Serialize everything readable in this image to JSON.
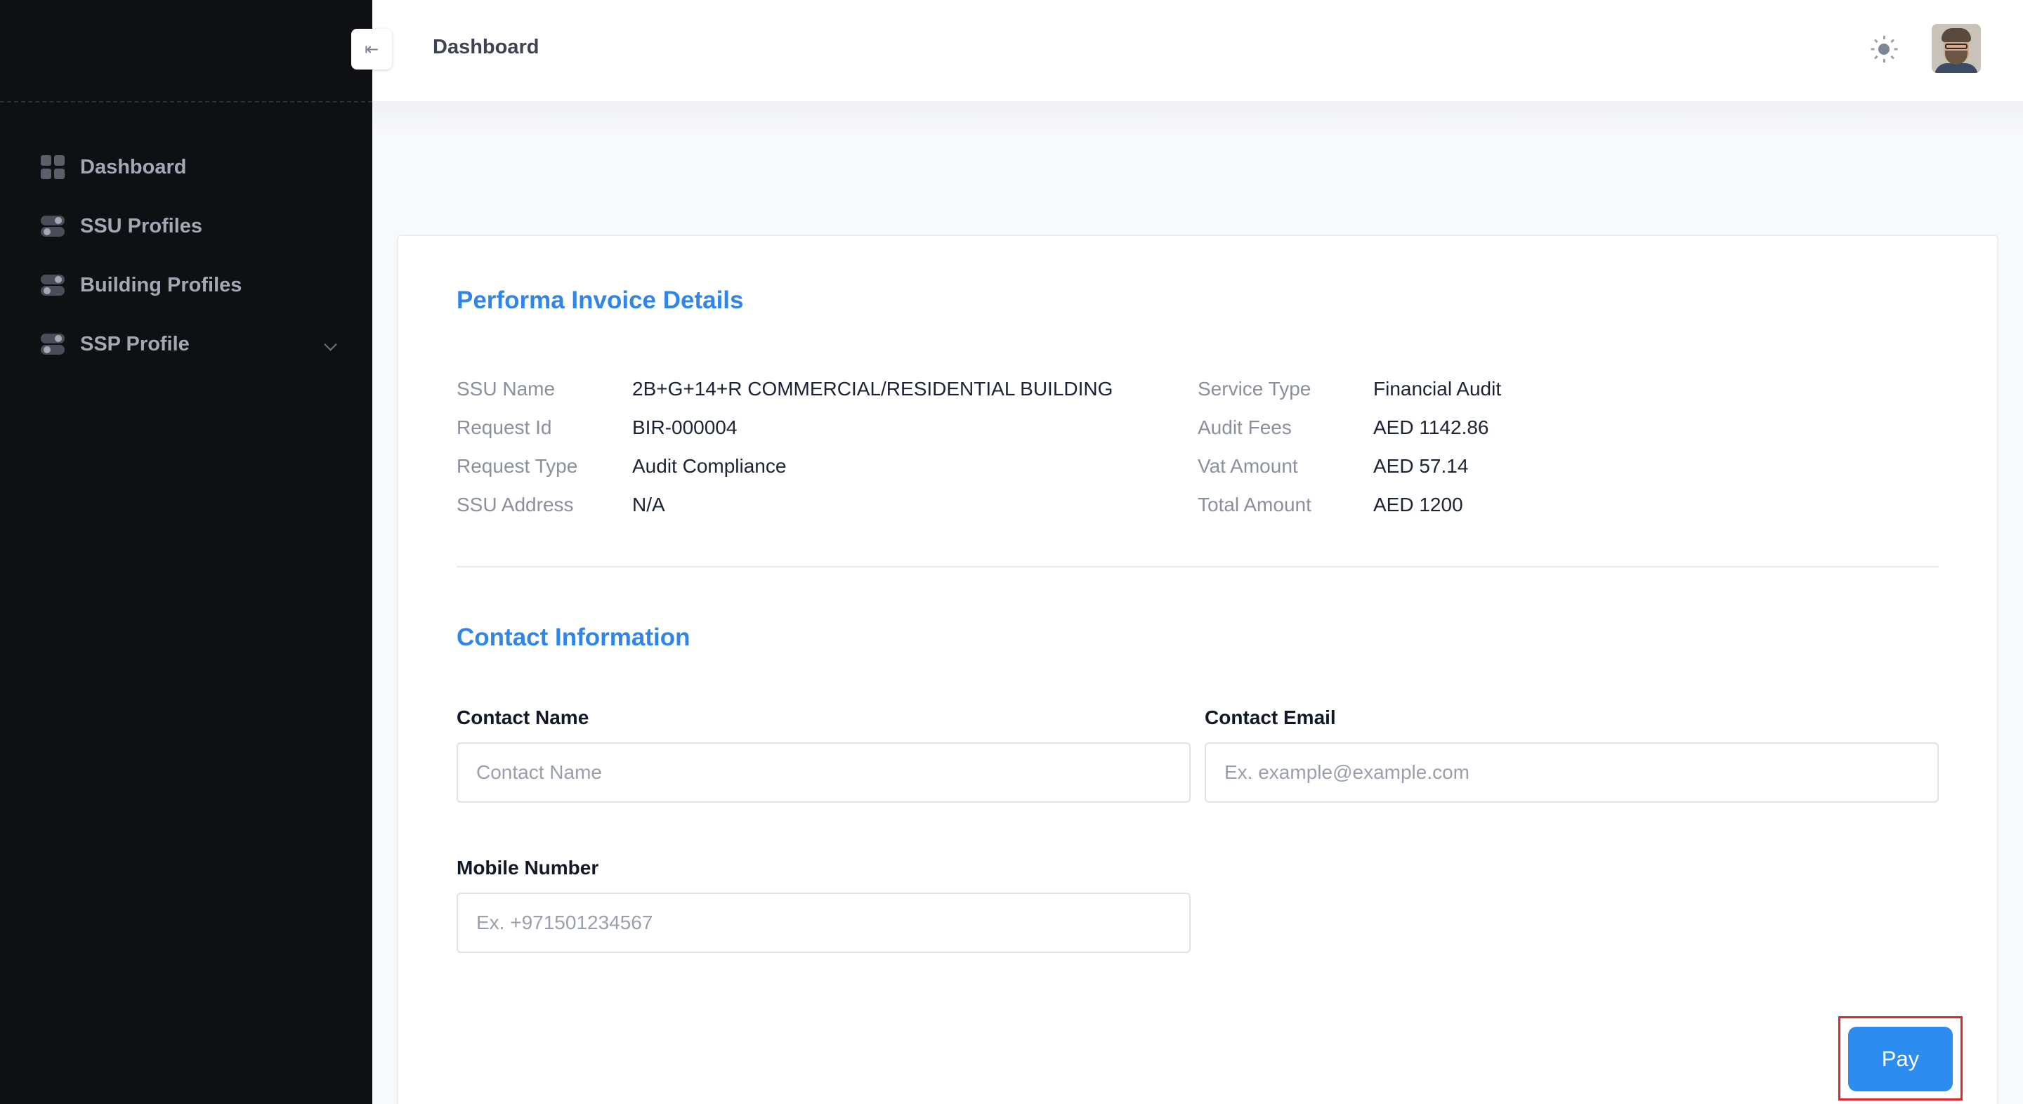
{
  "header": {
    "title": "Dashboard",
    "collapse_icon": "arrow-left-icon",
    "theme_icon": "sun-icon"
  },
  "sidebar": {
    "items": [
      {
        "label": "Dashboard",
        "icon": "grid-icon"
      },
      {
        "label": "SSU Profiles",
        "icon": "toggle-icon"
      },
      {
        "label": "Building Profiles",
        "icon": "toggle-icon"
      },
      {
        "label": "SSP Profile",
        "icon": "toggle-icon",
        "has_submenu": true
      }
    ]
  },
  "invoice": {
    "title": "Performa Invoice Details",
    "left": [
      {
        "label": "SSU Name",
        "value": "2B+G+14+R COMMERCIAL/RESIDENTIAL BUILDING"
      },
      {
        "label": "Request Id",
        "value": "BIR-000004"
      },
      {
        "label": "Request Type",
        "value": "Audit Compliance"
      },
      {
        "label": "SSU Address",
        "value": "N/A"
      }
    ],
    "right": [
      {
        "label": "Service Type",
        "value": "Financial Audit"
      },
      {
        "label": "Audit Fees",
        "value": "AED 1142.86"
      },
      {
        "label": "Vat Amount",
        "value": "AED 57.14"
      },
      {
        "label": "Total Amount",
        "value": "AED 1200"
      }
    ]
  },
  "contact": {
    "title": "Contact Information",
    "name": {
      "label": "Contact Name",
      "placeholder": "Contact Name",
      "value": ""
    },
    "email": {
      "label": "Contact Email",
      "placeholder": "Ex. example@example.com",
      "value": ""
    },
    "mobile": {
      "label": "Mobile Number",
      "placeholder": "Ex. +971501234567",
      "value": ""
    }
  },
  "actions": {
    "pay_label": "Pay"
  },
  "colors": {
    "accent": "#2f86e8",
    "pay_button": "#2d8cf0",
    "sidebar_bg": "#0f1014",
    "highlight": "#e3242b"
  }
}
